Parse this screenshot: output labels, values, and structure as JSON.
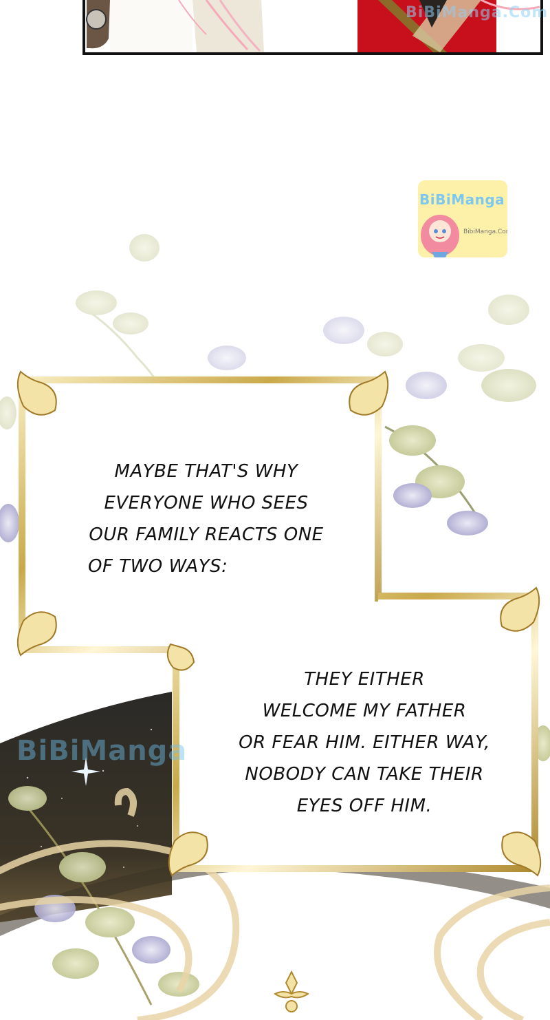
{
  "watermark": {
    "top_text": "BiBiManga.Com",
    "middle_text": "BiBiManga"
  },
  "badge": {
    "title": "BiBiManga",
    "subtitle": "BibiManga.Com"
  },
  "narration": {
    "box1_lines": [
      "MAYBE THAT'S WHY",
      "EVERYONE WHO SEES",
      "OUR FAMILY REACTS ONE",
      "OF TWO WAYS:"
    ],
    "box2_lines": [
      "THEY EITHER",
      "WELCOME MY FATHER",
      "OR FEAR HIM. EITHER WAY,",
      "NOBODY CAN TAKE THEIR",
      "EYES OFF HIM."
    ]
  },
  "colors": {
    "frame_gold": "#c9a94a",
    "frame_light": "#f3e3a6",
    "coat_red": "#c8101c",
    "hair_pink": "#f6a9b8",
    "foliage_green": "#c9cf9a",
    "foliage_purple": "#a9a6cf",
    "night_sky": "#2a2620"
  }
}
